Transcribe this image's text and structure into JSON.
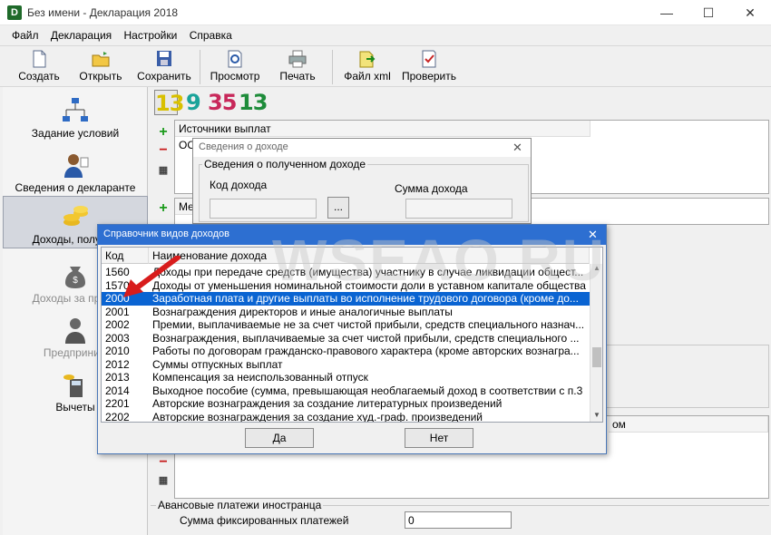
{
  "window": {
    "title": "Без имени - Декларация 2018",
    "app_icon_letter": "D",
    "min": "—",
    "max": "☐",
    "close": "✕"
  },
  "menu": [
    "Файл",
    "Декларация",
    "Настройки",
    "Справка"
  ],
  "toolbar": {
    "create": "Создать",
    "open": "Открыть",
    "save": "Сохранить",
    "preview": "Просмотр",
    "print": "Печать",
    "xml": "Файл xml",
    "check": "Проверить"
  },
  "nav": {
    "conditions": "Задание условий",
    "declarant": "Сведения о декларанте",
    "income": "Доходы, получен",
    "income_abroad": "Доходы за преде",
    "entrepreneur": "Предприним",
    "deductions": "Вычеты"
  },
  "tabs": [
    "13",
    "9",
    "35",
    "13"
  ],
  "colors": {
    "accent": "#2d6fd1",
    "selection": "#0a64d2",
    "tab1": "#d8c000",
    "tab2": "#1aa39a",
    "tab3": "#c8285a",
    "tab4": "#1e8c3a"
  },
  "sources_panel": {
    "header": "Источники выплат",
    "row1": "ООС"
  },
  "second_panel": {
    "header_partial": "Мес"
  },
  "lower_header_partial": "ом",
  "income_dialog": {
    "title": "Сведения о доходе",
    "group": "Сведения о полученном доходе",
    "code_label": "Код дохода",
    "sum_label": "Сумма дохода",
    "browse": "..."
  },
  "ref_dialog": {
    "title": "Справочник видов доходов",
    "close": "✕",
    "col_code": "Код",
    "col_name": "Наименование дохода",
    "rows": [
      {
        "code": "1560",
        "name": "Доходы при передаче средств (имущества) участнику в случае ликвидации общест..."
      },
      {
        "code": "1570",
        "name": "Доходы от уменьшения номинальной стоимости доли в уставном капитале общества"
      },
      {
        "code": "2000",
        "name": "Заработная плата и другие выплаты во исполнение трудового договора (кроме до..."
      },
      {
        "code": "2001",
        "name": "Вознаграждения директоров и иные аналогичные выплаты"
      },
      {
        "code": "2002",
        "name": "Премии, выплачиваемые не за счет чистой прибыли, средств специального назнач..."
      },
      {
        "code": "2003",
        "name": "Вознаграждения, выплачиваемые за счет чистой прибыли, средств специального ..."
      },
      {
        "code": "2010",
        "name": "Работы по договорам гражданско-правового характера (кроме авторских вознагра..."
      },
      {
        "code": "2012",
        "name": "Суммы отпускных выплат"
      },
      {
        "code": "2013",
        "name": "Компенсация за неиспользованный отпуск"
      },
      {
        "code": "2014",
        "name": "Выходное пособие (сумма, превышающая необлагаемый доход в соответствии с п.3 ..."
      },
      {
        "code": "2201",
        "name": "Авторские вознаграждения за создание литературных произведений"
      },
      {
        "code": "2202",
        "name": "Авторские вознаграждения за создание худ.-граф. произведений"
      }
    ],
    "selected_index": 2,
    "yes": "Да",
    "no": "Нет"
  },
  "advance": {
    "group": "Авансовые платежи иностранца",
    "label": "Сумма фиксированных платежей",
    "value": "0"
  },
  "watermark": "WSEAO.RU"
}
